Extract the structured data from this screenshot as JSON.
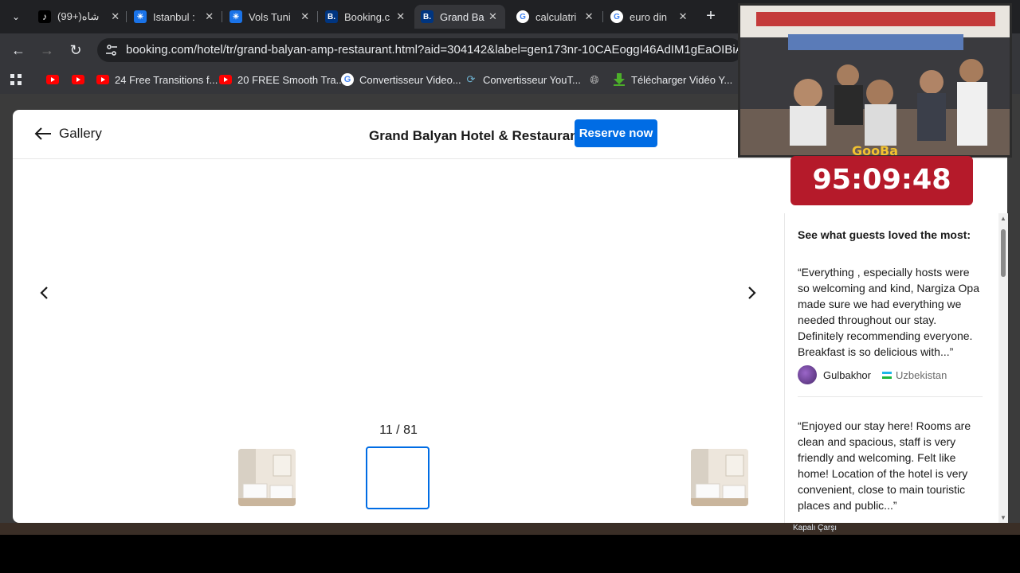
{
  "browser": {
    "tabs": [
      {
        "title": "شاه(+99)",
        "favicon": "tiktok-icon",
        "color": "#000000"
      },
      {
        "title": "Istanbul :",
        "favicon": "sun-logo-icon",
        "color": "#1a73e8"
      },
      {
        "title": "Vols Tuni",
        "favicon": "sun-logo-icon",
        "color": "#1a73e8"
      },
      {
        "title": "Booking.c",
        "favicon": "booking-icon",
        "color": "#003580"
      },
      {
        "title": "Grand Ba",
        "favicon": "booking-icon",
        "color": "#003580"
      },
      {
        "title": "calculatri",
        "favicon": "google-icon",
        "color": "#ffffff"
      },
      {
        "title": "euro din",
        "favicon": "google-icon",
        "color": "#ffffff"
      }
    ],
    "active_tab_index": 4,
    "url": "booking.com/hotel/tr/grand-balyan-amp-restaurant.html?aid=304142&label=gen173nr-10CAEoggI46AdIM1gEaOIBiAEBmA",
    "bookmarks": [
      {
        "label": "",
        "icon": "youtube-icon"
      },
      {
        "label": "",
        "icon": "youtube-icon"
      },
      {
        "label": "24 Free Transitions f...",
        "icon": "youtube-icon"
      },
      {
        "label": "20 FREE Smooth Tra...",
        "icon": "youtube-icon"
      },
      {
        "label": "Convertisseur Video...",
        "icon": "google-icon"
      },
      {
        "label": "Convertisseur YouT...",
        "icon": "convert-icon"
      },
      {
        "label": "",
        "icon": "globe-icon"
      },
      {
        "label": "Télécharger Vidéo Y...",
        "icon": "download-icon"
      }
    ]
  },
  "gallery": {
    "back_label": "Gallery",
    "hotel_name": "Grand Balyan Hotel & Restaurant",
    "reserve_label": "Reserve now",
    "counter": "11 / 81"
  },
  "reviews": {
    "title": "See what guests loved the most:",
    "items": [
      {
        "text": "“Everything , especially hosts were so welcoming and kind, Nargiza Opa made sure we had everything we needed throughout our stay. Definitely recommending everyone. Breakfast is so delicious with...”",
        "name": "Gulbakhor",
        "country": "Uzbekistan"
      },
      {
        "text": "“Enjoyed our stay here! Rooms are clean and spacious, staff is very friendly and welcoming. Felt like home! Location of the hotel is very convenient, close to main touristic places and public...”"
      }
    ]
  },
  "overlay": {
    "brand": "GooBa",
    "timer": "95:09:48",
    "map_label": "Kapalı Çarşı"
  }
}
